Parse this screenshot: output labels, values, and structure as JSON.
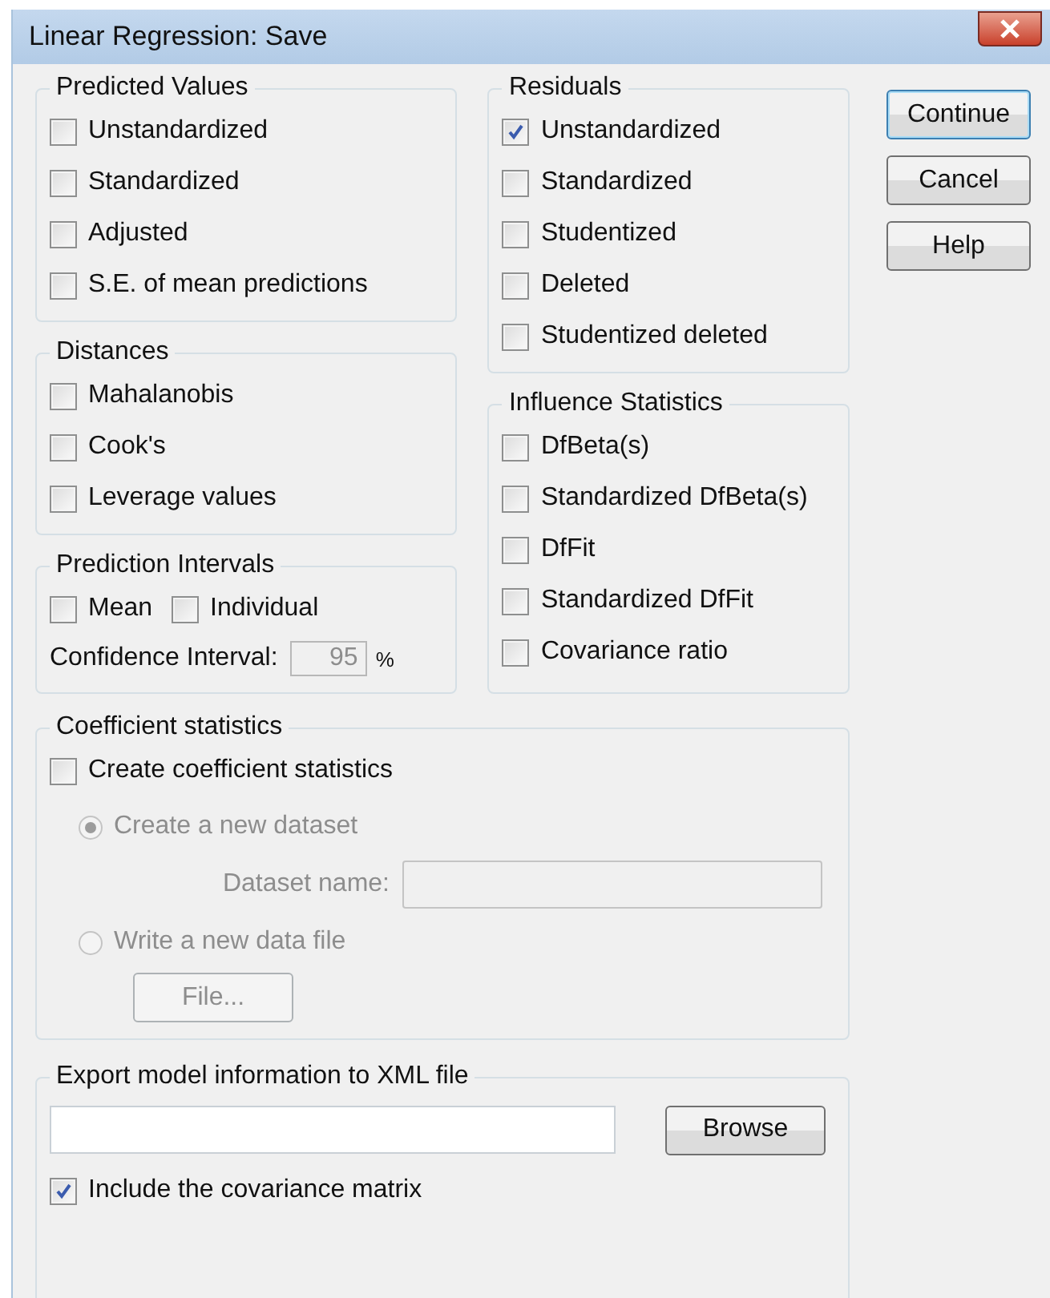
{
  "window": {
    "title": "Linear Regression: Save"
  },
  "predicted_values": {
    "title": "Predicted Values",
    "options": [
      {
        "label": "Unstandardized",
        "checked": false
      },
      {
        "label": "Standardized",
        "checked": false
      },
      {
        "label": "Adjusted",
        "checked": false
      },
      {
        "label": "S.E. of mean predictions",
        "checked": false
      }
    ]
  },
  "distances": {
    "title": "Distances",
    "options": [
      {
        "label": "Mahalanobis",
        "checked": false
      },
      {
        "label": "Cook's",
        "checked": false
      },
      {
        "label": "Leverage values",
        "checked": false
      }
    ]
  },
  "prediction_intervals": {
    "title": "Prediction Intervals",
    "options": [
      {
        "label": "Mean",
        "checked": false
      },
      {
        "label": "Individual",
        "checked": false
      }
    ],
    "confidence": {
      "label": "Confidence Interval:",
      "value": "95",
      "unit": "%",
      "disabled": true
    }
  },
  "residuals": {
    "title": "Residuals",
    "options": [
      {
        "label": "Unstandardized",
        "checked": true
      },
      {
        "label": "Standardized",
        "checked": false
      },
      {
        "label": "Studentized",
        "checked": false
      },
      {
        "label": "Deleted",
        "checked": false
      },
      {
        "label": "Studentized deleted",
        "checked": false
      }
    ]
  },
  "influence_statistics": {
    "title": "Influence Statistics",
    "options": [
      {
        "label": "DfBeta(s)",
        "checked": false
      },
      {
        "label": "Standardized DfBeta(s)",
        "checked": false
      },
      {
        "label": "DfFit",
        "checked": false
      },
      {
        "label": "Standardized DfFit",
        "checked": false
      },
      {
        "label": "Covariance ratio",
        "checked": false
      }
    ]
  },
  "coefficient_statistics": {
    "title": "Coefficient statistics",
    "create": {
      "label": "Create coefficient statistics",
      "checked": false
    },
    "choices": [
      {
        "label": "Create a new dataset",
        "selected": true,
        "disabled": true
      },
      {
        "label": "Write a new data file",
        "selected": false,
        "disabled": true
      }
    ],
    "dataset_name": {
      "label": "Dataset name:",
      "disabled": true
    },
    "file_button": {
      "label": "File...",
      "disabled": true
    }
  },
  "export": {
    "title": "Export model information to XML file",
    "browse": "Browse",
    "include": {
      "label": "Include the covariance matrix",
      "checked": true
    }
  },
  "buttons": [
    {
      "label": "Continue",
      "default": true
    },
    {
      "label": "Cancel",
      "default": false
    },
    {
      "label": "Help",
      "default": false
    }
  ]
}
